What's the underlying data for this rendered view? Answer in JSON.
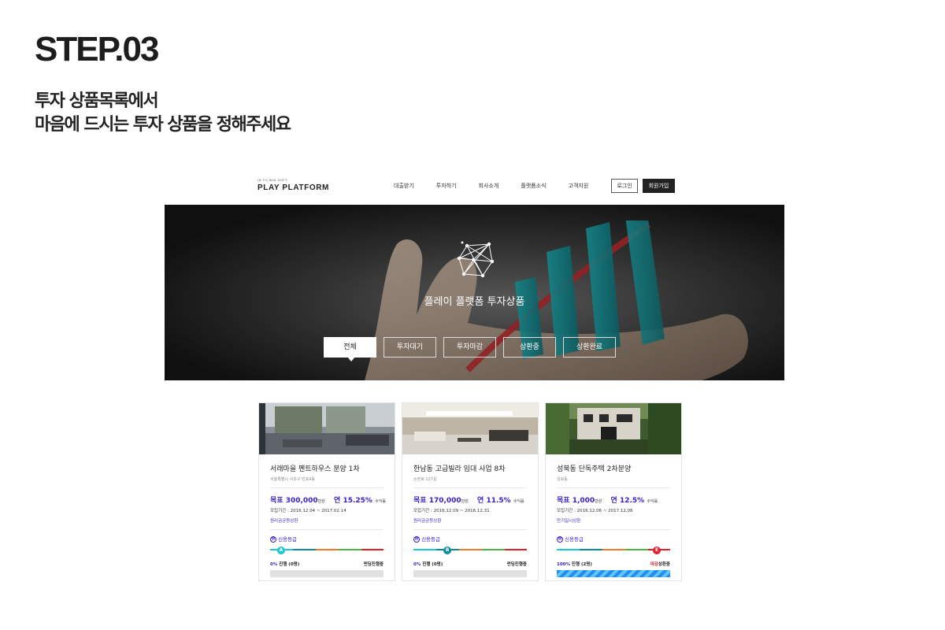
{
  "step": {
    "title": "STEP.03",
    "desc_line1": "투자 상품목록에서",
    "desc_line2": "마음에 드시는 투자 상품을 정해주세요"
  },
  "header": {
    "logo_small": "IN TO WIN SOFT",
    "logo_main": "PLAY PLATFORM",
    "nav": [
      "대출받기",
      "투자하기",
      "회사소개",
      "플랫폼소식",
      "고객지원"
    ],
    "login": "로그인",
    "join": "회원가입"
  },
  "hero": {
    "title": "플레이 플랫폼 투자상품",
    "tabs": [
      "전체",
      "투자대기",
      "투자마감",
      "상환중",
      "상환완료"
    ],
    "active_tab": "전체"
  },
  "cards": [
    {
      "name": "서래마을 펜트하우스 분양 1차",
      "address": "서울특별시 서초구 반포4동",
      "goal_label": "목표",
      "goal_amount": "300,000",
      "goal_unit": "만원",
      "rate_label": "연",
      "rate": "15.25%",
      "rate_unit": "수익률",
      "period": "모집기간 : 2016.12.04 ~ 2017.02.14",
      "repay_type": "원리금균등상환",
      "grade_label": "신용등급",
      "grade": "A",
      "grade_color": "#1bc6d6",
      "progress_pct": "0%",
      "progress_text": "진행 (0명)",
      "status": "펀딩진행중",
      "status_highlight": "",
      "progress_value": 0
    },
    {
      "name": "한남동 고급빌라 임대 사업 8차",
      "address": "논현로 127길",
      "goal_label": "목표",
      "goal_amount": "170,000",
      "goal_unit": "만원",
      "rate_label": "연",
      "rate": "11.5%",
      "rate_unit": "수익률",
      "period": "모집기간 : 2016.12.09 ~ 2016.12.31",
      "repay_type": "원리금균등상환",
      "grade_label": "신용등급",
      "grade": "B",
      "grade_color": "#0e8a99",
      "progress_pct": "0%",
      "progress_text": "진행 (0명)",
      "status": "펀딩진행중",
      "status_highlight": "",
      "progress_value": 0
    },
    {
      "name": "성북동 단독주택 2차분양",
      "address": "성북동",
      "goal_label": "목표",
      "goal_amount": "1,000",
      "goal_unit": "만원",
      "rate_label": "연",
      "rate": "12.5%",
      "rate_unit": "수익률",
      "period": "모집기간 : 2016.12.06 ~ 2017.12.06",
      "repay_type": "만기일시상환",
      "grade_label": "신용등급",
      "grade": "E",
      "grade_color": "#e0202a",
      "progress_pct": "100%",
      "progress_text": "진행 (2명)",
      "status": "상환중",
      "status_highlight": "마감",
      "progress_value": 1
    }
  ]
}
